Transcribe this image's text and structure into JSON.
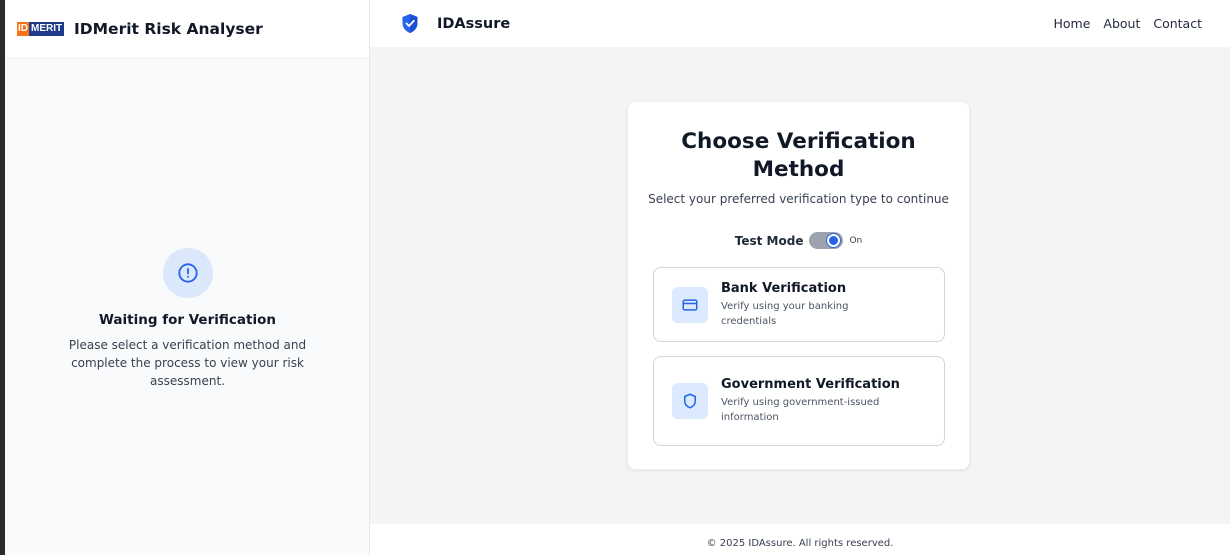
{
  "left": {
    "logo_id": "ID",
    "logo_merit": "MERIT",
    "title": "IDMerit Risk Analyser",
    "status_title": "Waiting for Verification",
    "status_text": "Please select a verification method and complete the process to view your risk assessment.",
    "status_icon": "alert-circle-icon"
  },
  "navbar": {
    "brand": "IDAssure",
    "brand_icon": "shield-check-icon",
    "links": [
      "Home",
      "About",
      "Contact"
    ]
  },
  "card": {
    "title": "Choose Verification Method",
    "subtitle": "Select your preferred verification type to continue",
    "test_mode_label": "Test Mode",
    "test_mode_state": "On",
    "test_mode_enabled": true,
    "options": [
      {
        "title": "Bank Verification",
        "description": "Verify using your banking credentials",
        "icon": "credit-card-icon"
      },
      {
        "title": "Government Verification",
        "description": "Verify using government-issued information",
        "icon": "shield-icon"
      }
    ]
  },
  "footer": {
    "text": "© 2025 IDAssure. All rights reserved."
  },
  "colors": {
    "accent": "#2563eb",
    "icon_bg": "#dbeafe",
    "logo_orange": "#f97316",
    "logo_navy": "#1e3a8a"
  }
}
